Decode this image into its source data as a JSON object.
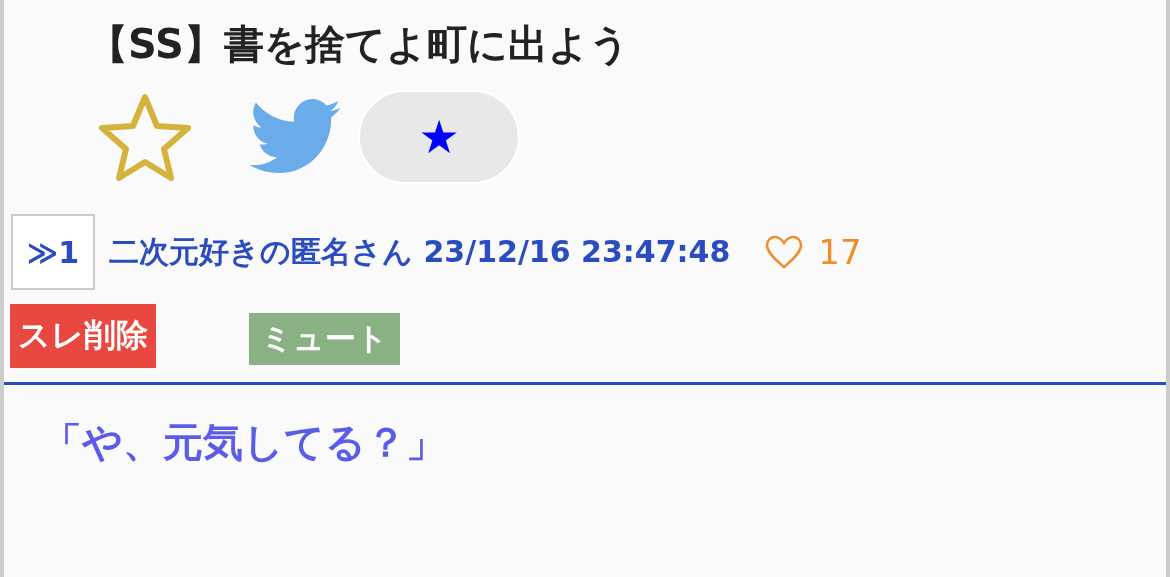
{
  "title": "【SS】書を捨てよ町に出よう",
  "favorite": {
    "on": false
  },
  "share_button": {
    "label": "★"
  },
  "post": {
    "anchor": "≫1",
    "author_line": "二次元好きの匿名さん 23/12/16 23:47:48",
    "likes": "17",
    "liked": false,
    "actions": [
      {
        "label": "スレ削除",
        "color": "#e8483f"
      },
      {
        "label": "ミュート",
        "color": "#8ab184"
      }
    ],
    "body": "「や、元気してる？」"
  }
}
